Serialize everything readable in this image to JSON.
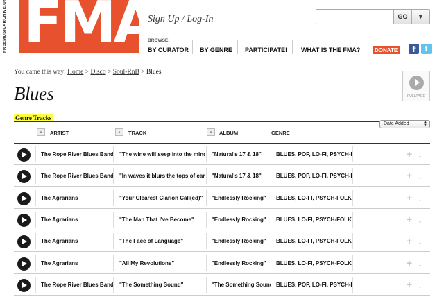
{
  "header": {
    "logo_text": "FMA",
    "logo_side_text": "FREEMUSICARCHIVE.ORG",
    "signup_label": "Sign Up / Log-In",
    "search_placeholder": "",
    "go_label": "GO",
    "dropdown_icon": "chevron-down-icon",
    "browse_label": "BROWSE:",
    "nav": [
      {
        "label": "BY CURATOR"
      },
      {
        "label": "BY GENRE"
      },
      {
        "label": "PARTICIPATE!"
      },
      {
        "label": "WHAT IS THE FMA?"
      }
    ],
    "donate_label": "DONATE",
    "facebook_glyph": "f",
    "twitter_glyph": "t",
    "brand_color": "#e8512d"
  },
  "breadcrumb": {
    "prefix": "You came this way:",
    "items": [
      "Home",
      "Disco",
      "Soul-RnB"
    ],
    "separator": ">",
    "current": "Blues"
  },
  "page": {
    "title": "Blues",
    "fullpage_label": "FULLPAGE",
    "section_label": "Genre Tracks",
    "sort_value": "Date Added"
  },
  "table": {
    "columns": [
      "ARTIST",
      "TRACK",
      "ALBUM",
      "GENRE"
    ],
    "rows": [
      {
        "artist": "The Rope River Blues Band",
        "track": "\"The wine will seep into the mind o",
        "album": "\"Natural's 17 & 18\"",
        "genre": "BLUES, POP, LO-FI, PSYCH-ROCK"
      },
      {
        "artist": "The Rope River Blues Band",
        "track": "\"In waves it blurs the tops of cars.\"",
        "album": "\"Natural's 17 & 18\"",
        "genre": "BLUES, POP, LO-FI, PSYCH-ROCK"
      },
      {
        "artist": "The Agrarians",
        "track": "\"Your Clearest Clarion Call(ed)\"",
        "album": "\"Endlessly Rocking\"",
        "genre": "BLUES, LO-FI, PSYCH-FOLK, PSYC"
      },
      {
        "artist": "The Agrarians",
        "track": "\"The Man That I've Become\"",
        "album": "\"Endlessly Rocking\"",
        "genre": "BLUES, LO-FI, PSYCH-FOLK, PSYC"
      },
      {
        "artist": "The Agrarians",
        "track": "\"The Face of Language\"",
        "album": "\"Endlessly Rocking\"",
        "genre": "BLUES, LO-FI, PSYCH-FOLK, PSYC"
      },
      {
        "artist": "The Agrarians",
        "track": "\"All My Revolutions\"",
        "album": "\"Endlessly Rocking\"",
        "genre": "BLUES, LO-FI, PSYCH-FOLK, PSYC"
      },
      {
        "artist": "The Rope River Blues Band",
        "track": "\"The Something Sound\"",
        "album": "\"The Something Sound\"",
        "genre": "BLUES, POP, LO-FI, PSYCH-ROCK,"
      }
    ]
  }
}
